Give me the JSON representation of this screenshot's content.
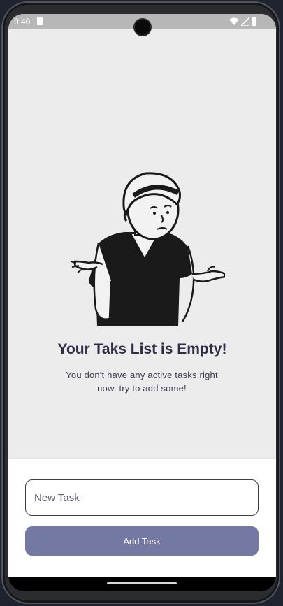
{
  "status_bar": {
    "time": "9:40",
    "icons": [
      "sim-card-icon",
      "wifi-icon",
      "signal-icon",
      "battery-icon"
    ]
  },
  "empty_state": {
    "illustration": "shrugging-person-illustration",
    "title": "Your Taks List is Empty!",
    "message": "You don't have any active tasks right now. try to add some!"
  },
  "new_task": {
    "placeholder": "New Task",
    "value": "",
    "button_label": "Add Task"
  },
  "colors": {
    "background": "#ececec",
    "title": "#2e2f45",
    "button": "#7479a3",
    "sheet": "#ffffff"
  }
}
